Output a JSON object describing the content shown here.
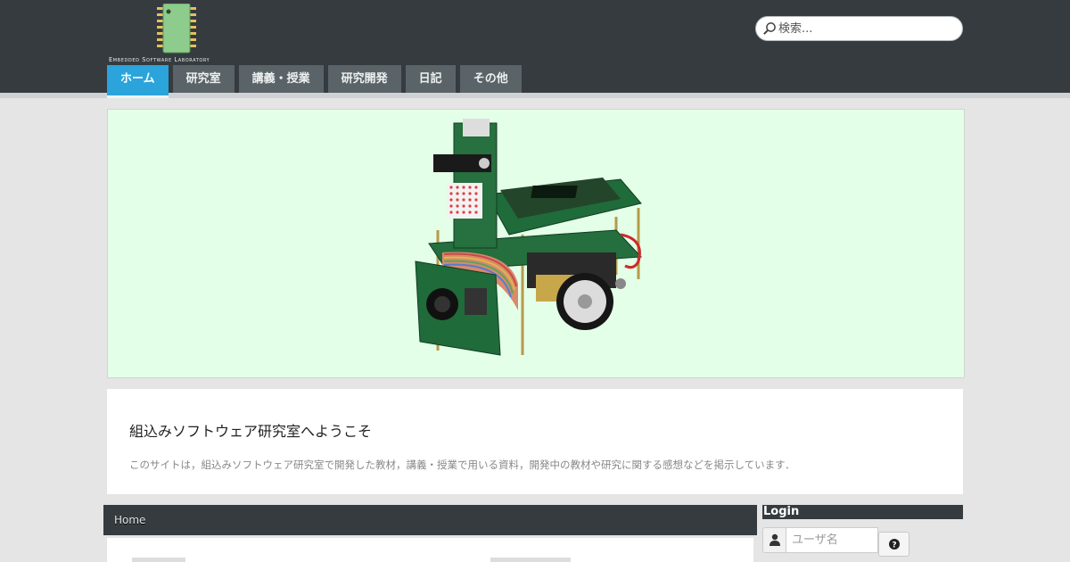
{
  "logo": {
    "text": "Embedded Software Laboratory",
    "icon": "chip-icon"
  },
  "search": {
    "placeholder": "検索...",
    "icon": "search-icon"
  },
  "nav": {
    "items": [
      {
        "label": "ホーム",
        "active": true
      },
      {
        "label": "研究室"
      },
      {
        "label": "講義・授業"
      },
      {
        "label": "研究開発"
      },
      {
        "label": "日記"
      },
      {
        "label": "その他"
      }
    ]
  },
  "banner": {
    "image": "robot-photo"
  },
  "welcome": {
    "title": "組込みソフトウェア研究室へようこそ",
    "text": "このサイトは，組込みソフトウェア研究室で開発した教材，講義・授業で用いる資料，開発中の教材や研究に関する感想などを掲示しています．"
  },
  "breadcrumb": {
    "label": "Home"
  },
  "login": {
    "title": "Login",
    "username_placeholder": "ユーザ名",
    "user_icon": "user-icon",
    "help_icon": "question-icon"
  },
  "colors": {
    "header_bg": "#353b3f",
    "nav_active": "#2aa4db",
    "nav_item": "#5a6468",
    "banner_bg": "#e4ffe8",
    "page_bg": "#e5e5e5"
  }
}
